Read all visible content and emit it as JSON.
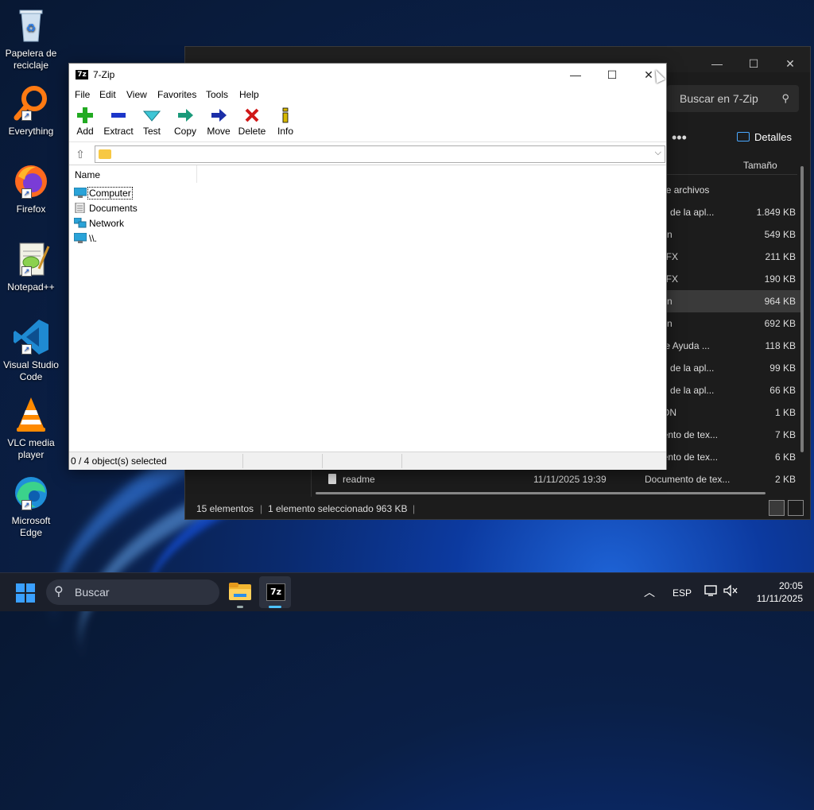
{
  "desktop": {
    "icons": [
      {
        "label": "Papelera de reciclaje",
        "icon": "recycle-bin-icon"
      },
      {
        "label": "Everything",
        "icon": "everything-search-icon"
      },
      {
        "label": "Firefox",
        "icon": "firefox-icon"
      },
      {
        "label": "Notepad++",
        "icon": "notepad-plus-plus-icon"
      },
      {
        "label": "Visual Studio Code",
        "icon": "vscode-icon"
      },
      {
        "label": "VLC media player",
        "icon": "vlc-icon"
      },
      {
        "label": "Microsoft Edge",
        "icon": "edge-icon"
      }
    ]
  },
  "explorer": {
    "search_placeholder": "Buscar en 7-Zip",
    "more": "•••",
    "details_label": "Detalles",
    "column_size": "Tamaño",
    "rows": [
      {
        "type": "eta de archivos",
        "size": ""
      },
      {
        "type": "nsión de la apl...",
        "size": "1.849 KB"
      },
      {
        "type": "cación",
        "size": "549 KB"
      },
      {
        "type": "ivo SFX",
        "size": "211 KB"
      },
      {
        "type": "ivo SFX",
        "size": "190 KB"
      },
      {
        "type": "cación",
        "size": "964 KB",
        "selected": true
      },
      {
        "type": "cación",
        "size": "692 KB"
      },
      {
        "type": "ivo de Ayuda ...",
        "size": "118 KB"
      },
      {
        "type": "nsión de la apl...",
        "size": "99 KB"
      },
      {
        "type": "nsión de la apl...",
        "size": "66 KB"
      },
      {
        "type": "ivo ION",
        "size": "1 KB"
      },
      {
        "type": "cumento de tex...",
        "size": "7 KB"
      },
      {
        "type": "cumento de tex...",
        "size": "6 KB"
      }
    ],
    "last_row": {
      "name": "readme",
      "date": "11/11/2025 19:39",
      "type": "Documento de tex...",
      "size": "2 KB"
    },
    "status_count": "15 elementos",
    "status_selected": "1 elemento seleccionado  963 KB"
  },
  "sevenzip": {
    "title": "7-Zip",
    "logo": "7z",
    "menu": [
      "File",
      "Edit",
      "View",
      "Favorites",
      "Tools",
      "Help"
    ],
    "toolbar": [
      {
        "label": "Add",
        "icon": "add-icon",
        "color": "#1fa01f"
      },
      {
        "label": "Extract",
        "icon": "extract-icon",
        "color": "#1c36c9"
      },
      {
        "label": "Test",
        "icon": "test-icon",
        "color": "#1aa7b8"
      },
      {
        "label": "Copy",
        "icon": "copy-icon",
        "color": "#1a9a7a"
      },
      {
        "label": "Move",
        "icon": "move-icon",
        "color": "#1c2fa8"
      },
      {
        "label": "Delete",
        "icon": "delete-icon",
        "color": "#d01818"
      },
      {
        "label": "Info",
        "icon": "info-icon",
        "color": "#d6b800"
      }
    ],
    "column_name": "Name",
    "items": [
      {
        "label": "Computer",
        "icon": "computer-icon"
      },
      {
        "label": "Documents",
        "icon": "documents-icon"
      },
      {
        "label": "Network",
        "icon": "network-icon"
      },
      {
        "label": "\\\\.",
        "icon": "drive-icon"
      }
    ],
    "status": "0 / 4 object(s) selected"
  },
  "taskbar": {
    "search_placeholder": "Buscar",
    "language": "ESP",
    "time": "20:05",
    "date": "11/11/2025",
    "accent": "#4cc2ff"
  }
}
